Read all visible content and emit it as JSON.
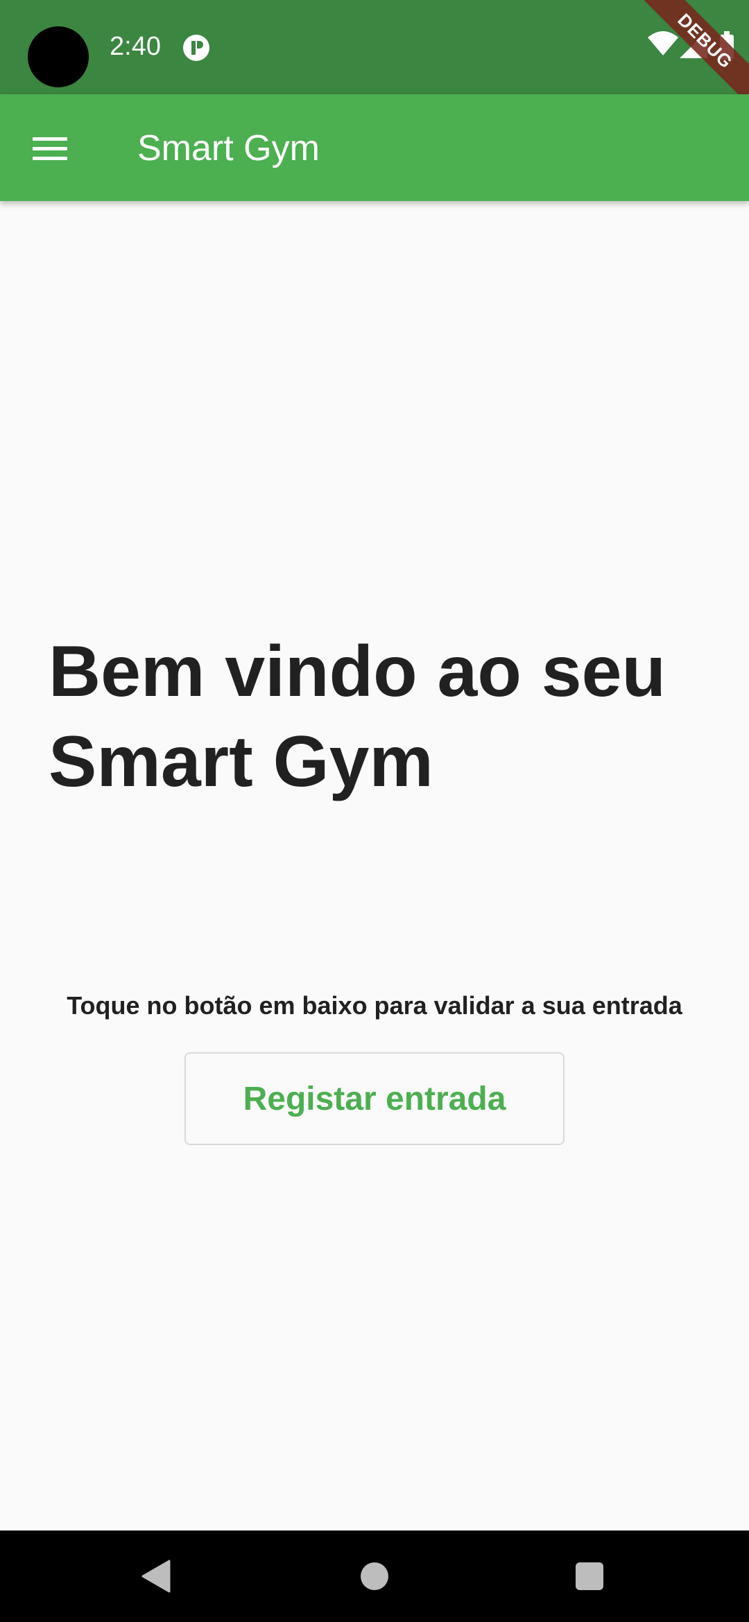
{
  "status_bar": {
    "time": "2:40",
    "icons": [
      "camera-cutout",
      "app-notification-icon",
      "wifi-icon",
      "signal-icon",
      "battery-icon"
    ]
  },
  "debug_banner": {
    "label": "DEBUG"
  },
  "app_bar": {
    "title": "Smart Gym",
    "menu_icon": "hamburger-menu-icon",
    "color": "#4caf50",
    "status_color": "#3b8641"
  },
  "main": {
    "welcome_title": "Bem vindo ao seu Smart Gym",
    "instruction": "Toque no botão em baixo para validar a sua entrada",
    "register_button_label": "Registar entrada"
  },
  "nav_bar": {
    "icons": [
      "back-icon",
      "home-icon",
      "recents-icon"
    ]
  }
}
